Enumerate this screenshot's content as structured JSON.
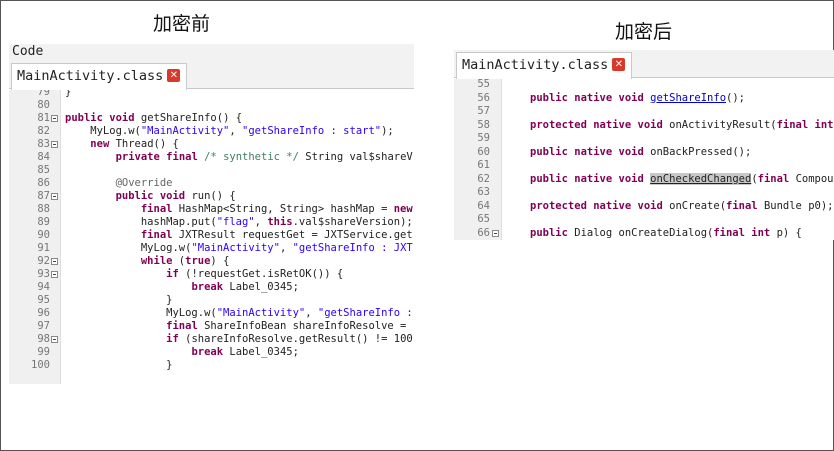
{
  "captions": {
    "before": "加密前",
    "after": "加密后"
  },
  "left_panel": {
    "header": "Code",
    "tab": "MainActivity.class",
    "lines": [
      {
        "n": "79",
        "t": "}"
      },
      {
        "n": "80",
        "t": ""
      },
      {
        "n": "81",
        "t": "public void getShareInfo() {"
      },
      {
        "n": "82",
        "t": "    MyLog.w(\"MainActivity\", \"getShareInfo : start\");"
      },
      {
        "n": "83",
        "t": "    new Thread() {"
      },
      {
        "n": "84",
        "t": "        private final /* synthetic */ String val$shareV"
      },
      {
        "n": "85",
        "t": ""
      },
      {
        "n": "86",
        "t": "        @Override"
      },
      {
        "n": "87",
        "t": "        public void run() {"
      },
      {
        "n": "88",
        "t": "            final HashMap<String, String> hashMap = new"
      },
      {
        "n": "89",
        "t": "            hashMap.put(\"flag\", this.val$shareVersion);"
      },
      {
        "n": "90",
        "t": "            final JXTResult requestGet = JXTService.get"
      },
      {
        "n": "91",
        "t": "            MyLog.w(\"MainActivity\", \"getShareInfo : JXT"
      },
      {
        "n": "92",
        "t": "            while (true) {"
      },
      {
        "n": "93",
        "t": "                if (!requestGet.isRetOK()) {"
      },
      {
        "n": "94",
        "t": "                    break Label_0345;"
      },
      {
        "n": "95",
        "t": "                }"
      },
      {
        "n": "96",
        "t": "                MyLog.w(\"MainActivity\", \"getShareInfo :"
      },
      {
        "n": "97",
        "t": "                final ShareInfoBean shareInfoResolve ="
      },
      {
        "n": "98",
        "t": "                if (shareInfoResolve.getResult() != 100"
      },
      {
        "n": "99",
        "t": "                    break Label_0345;"
      },
      {
        "n": "100",
        "t": "                }"
      }
    ]
  },
  "right_panel": {
    "tab": "MainActivity.class",
    "lines": [
      {
        "n": "55",
        "t": ""
      },
      {
        "n": "56",
        "t": "public native void getShareInfo();"
      },
      {
        "n": "57",
        "t": ""
      },
      {
        "n": "58",
        "t": "protected native void onActivityResult(final int"
      },
      {
        "n": "59",
        "t": ""
      },
      {
        "n": "60",
        "t": "public native void onBackPressed();"
      },
      {
        "n": "61",
        "t": ""
      },
      {
        "n": "62",
        "t": "public native void onCheckedChanged(final Compou"
      },
      {
        "n": "63",
        "t": ""
      },
      {
        "n": "64",
        "t": "protected native void onCreate(final Bundle p0);"
      },
      {
        "n": "65",
        "t": ""
      },
      {
        "n": "66",
        "t": "public Dialog onCreateDialog(final int p) {"
      }
    ]
  }
}
